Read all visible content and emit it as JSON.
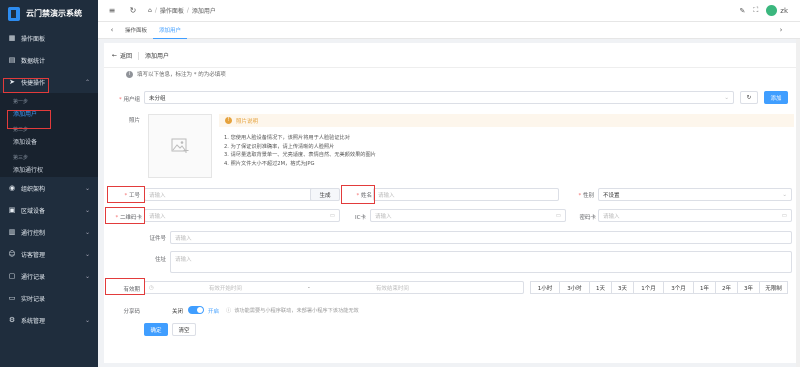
{
  "app": {
    "title": "云门禁演示系统"
  },
  "sidebar": {
    "items": [
      {
        "label": "操作面板",
        "icon": "dashboard-icon"
      },
      {
        "label": "数据统计",
        "icon": "chart-icon"
      },
      {
        "label": "快捷操作",
        "icon": "send-icon"
      }
    ],
    "quick": {
      "steps": [
        {
          "group": "第一步",
          "label": "添加用户"
        },
        {
          "group": "第二步",
          "label": "添加设备"
        },
        {
          "group": "第三步",
          "label": "添加通行权"
        }
      ]
    },
    "lower": [
      {
        "label": "组织架构",
        "icon": "org-icon"
      },
      {
        "label": "区域设备",
        "icon": "device-icon"
      },
      {
        "label": "通行控制",
        "icon": "control-icon"
      },
      {
        "label": "访客管理",
        "icon": "visitor-icon"
      },
      {
        "label": "通行记录",
        "icon": "record-icon"
      },
      {
        "label": "实时记录",
        "icon": "realtime-icon"
      },
      {
        "label": "系统管理",
        "icon": "settings-icon"
      }
    ]
  },
  "topbar": {
    "breadcrumb": [
      "操作面板",
      "添加用户"
    ],
    "user": "zk"
  },
  "tabs": [
    {
      "label": "操作面板",
      "active": false
    },
    {
      "label": "添加用户",
      "active": true
    }
  ],
  "page": {
    "back_label": "返回",
    "title": "添加用户",
    "notice": "填写以下信息，标注为 * 的为必填项"
  },
  "form": {
    "group_label": "用户组",
    "group_value": "未分组",
    "add_label": "添加",
    "photo_label": "照片",
    "photo_note_title": "照片说明",
    "photo_rules": [
      "1. 您使用人脸设备情况下，该照片将用于人脸验证比对",
      "2. 为了保证识别准确率，请上传清晰的人脸照片",
      "3. 请尽量选取背景单一、光亮适度、表情自然、无美颜效果的图片",
      "4. 照片文件大小不超过2M，格式为JPG"
    ],
    "job_label": "工号",
    "job_placeholder": "请输入",
    "generate_label": "生成",
    "name_label": "姓名",
    "name_placeholder": "请输入",
    "gender_label": "性别",
    "gender_value": "不设置",
    "qr_label": "二维码卡",
    "qr_placeholder": "请输入",
    "ic_label": "IC卡",
    "ic_placeholder": "请输入",
    "pwd_label": "密码卡",
    "pwd_placeholder": "请输入",
    "id_label": "证件号",
    "id_placeholder": "请输入",
    "addr_label": "住址",
    "addr_placeholder": "请输入",
    "valid_label": "有效期",
    "valid_start": "有效开始时间",
    "valid_to": "-",
    "valid_end": "有效结束时间",
    "periods": [
      "1小时",
      "3小时",
      "1天",
      "3天",
      "1个月",
      "3个月",
      "1年",
      "2年",
      "3年",
      "无限制"
    ],
    "share_label": "分享码",
    "share_off": "关闭",
    "share_on": "开启",
    "share_note": "该功能需要与小程序联动，未部署小程序下该功能无效",
    "submit_label": "确定",
    "reset_label": "清空"
  },
  "colors": {
    "accent": "#409eff",
    "sidebar_bg": "#1f2d3d",
    "highlight": "#e23b3b"
  }
}
